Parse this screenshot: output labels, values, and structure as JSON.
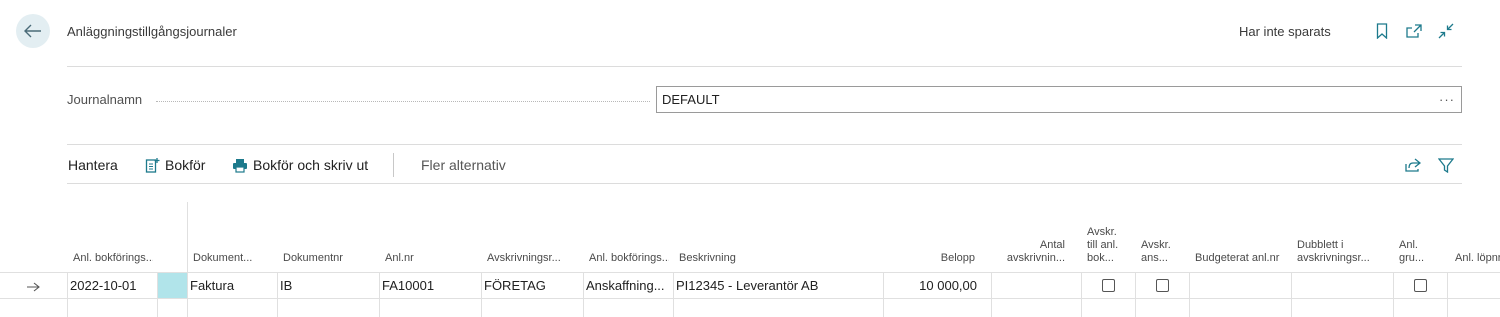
{
  "header": {
    "title": "Anläggningstillgångsjournaler",
    "status": "Har inte sparats"
  },
  "journal": {
    "label": "Journalnamn",
    "value": "DEFAULT",
    "more": "···"
  },
  "actions": {
    "manage": "Hantera",
    "post": "Bokför",
    "post_print": "Bokför och skriv ut",
    "more_options": "Fler alternativ"
  },
  "columns": {
    "c1": "Anl. bokförings...",
    "c2": "Dokument...",
    "c3": "Dokumentnr",
    "c4": "Anl.nr",
    "c5": "Avskrivningsr...",
    "c6": "Anl. bokförings...",
    "c7": "Beskrivning",
    "c8": "Belopp",
    "c9": "Antal avskrivnin...",
    "c10": "Avskr. till anl. bok...",
    "c11": "Avskr. ans...",
    "c12": "Budgeterat anl.nr",
    "c13": "Dubblett i avskrivningsr...",
    "c14": "Anl. gru...",
    "c15": "Anl. löpnr"
  },
  "row": {
    "date": "2022-10-01",
    "doc_type": "Faktura",
    "doc_no": "IB",
    "fa_no": "FA10001",
    "depr_book": "FÖRETAG",
    "posting_type": "Anskaffning...",
    "description": "PI12345 - Leverantör AB",
    "amount": "10 000,00"
  }
}
